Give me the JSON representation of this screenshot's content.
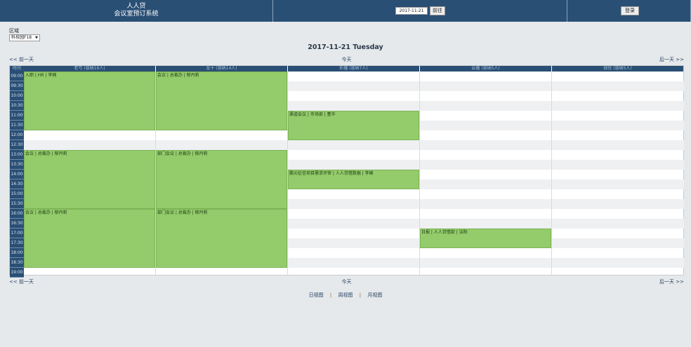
{
  "header": {
    "title_line1": "人人贷",
    "title_line2": "会议室预订系统",
    "date_value": "2017-11-21",
    "goto_label": "前往",
    "login_label": "登录"
  },
  "area": {
    "label": "区域",
    "selected": "科技园F18"
  },
  "date_title": "2017-11-21 Tuesday",
  "nav": {
    "prev": "<< 前一天",
    "today": "今天",
    "next": "后一天 >>"
  },
  "grid": {
    "time_header": "时间",
    "rooms": [
      {
        "name": "老弓 (容纳16人)"
      },
      {
        "name": "龙十 (容纳14人)"
      },
      {
        "name": "彩播 (容纳7人)"
      },
      {
        "name": "云播 (容纳5人)"
      },
      {
        "name": "规优 (容纳5人)"
      }
    ],
    "times": [
      "09:00",
      "09:30",
      "10:00",
      "10:30",
      "11:00",
      "11:30",
      "12:00",
      "12:30",
      "13:00",
      "13:30",
      "14:00",
      "14:30",
      "15:00",
      "15:30",
      "16:00",
      "16:30",
      "17:00",
      "17:30",
      "18:00",
      "18:30",
      "19:00"
    ],
    "bookings": [
      {
        "room": 0,
        "start": 0,
        "slots": 6,
        "text": "入职 | HR | 李楠"
      },
      {
        "room": 1,
        "start": 0,
        "slots": 6,
        "text": "会议 | 总裁办 | 郁丹莉"
      },
      {
        "room": 2,
        "start": 4,
        "slots": 3,
        "text": "渠道会议 | 市场部 | 董华"
      },
      {
        "room": 0,
        "start": 8,
        "slots": 6,
        "text": "会议 | 总裁办 | 郁丹莉"
      },
      {
        "room": 1,
        "start": 8,
        "slots": 6,
        "text": "部门会议 | 总裁办 | 郁丹莉"
      },
      {
        "room": 2,
        "start": 10,
        "slots": 2,
        "text": "鹏元征信项目需求评审 | 人人贷借数据 | 李峰"
      },
      {
        "room": 0,
        "start": 14,
        "slots": 6,
        "text": "会议 | 总裁办 | 郁丹莉"
      },
      {
        "room": 1,
        "start": 14,
        "slots": 6,
        "text": "部门会议 | 总裁办 | 郁丹莉"
      },
      {
        "room": 3,
        "start": 16,
        "slots": 2,
        "text": "日报 | 人人贷借款 | 洁阳"
      }
    ]
  },
  "footer": {
    "links": [
      "日视图",
      "周视图",
      "月视图"
    ],
    "separator": "|"
  }
}
